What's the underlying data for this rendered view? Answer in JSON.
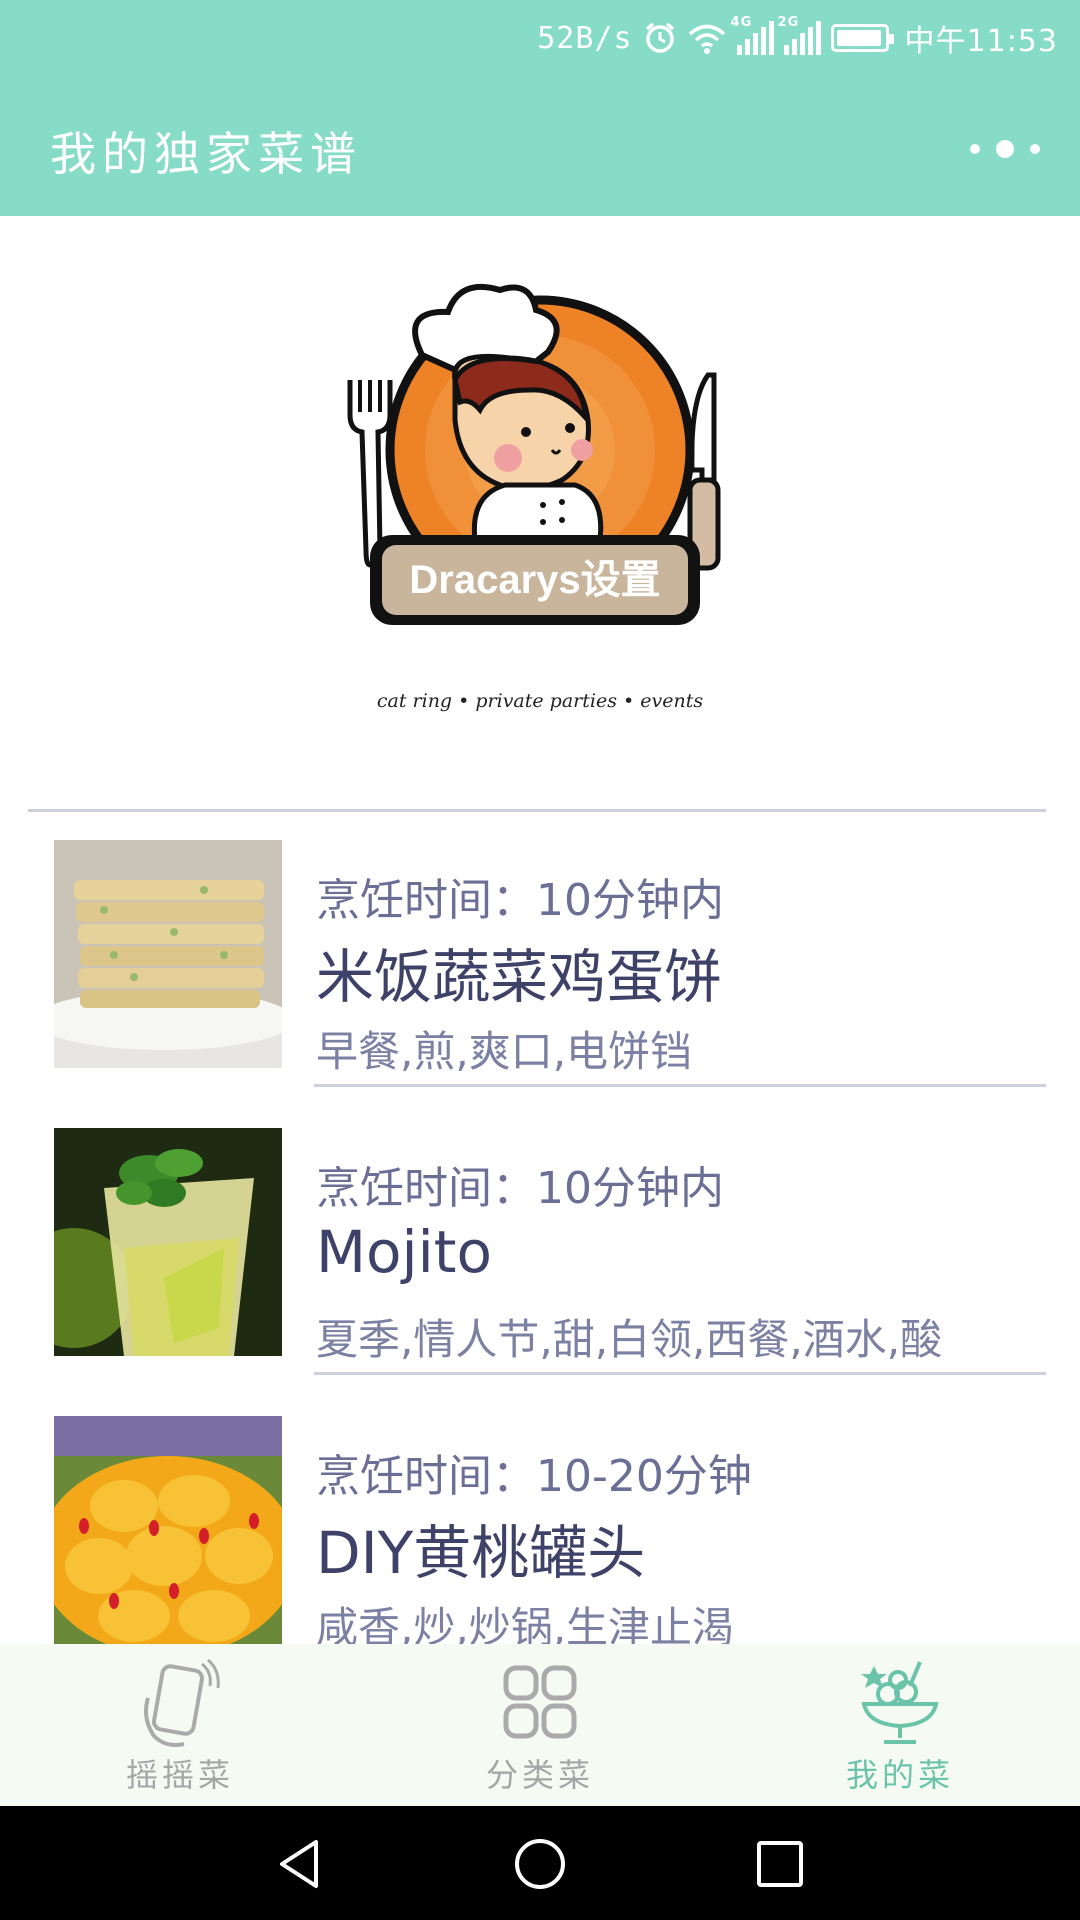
{
  "status_bar": {
    "net_speed": "52B/s",
    "signal1_tag": "4G",
    "signal2_tag": "2G",
    "time": "中午11:53"
  },
  "app_bar": {
    "title": "我的独家菜谱"
  },
  "logo": {
    "badge_text": "Dracarys设置",
    "tagline": "cat ring • private parties • events"
  },
  "recipes": [
    {
      "time": "烹饪时间：10分钟内",
      "name": "米饭蔬菜鸡蛋饼",
      "tags": "早餐,煎,爽口,电饼铛"
    },
    {
      "time": "烹饪时间：10分钟内",
      "name": "Mojito",
      "tags": "夏季,情人节,甜,白领,西餐,酒水,酸"
    },
    {
      "time": "烹饪时间：10-20分钟",
      "name": "DIY黄桃罐头",
      "tags": "咸香,炒,炒锅,生津止渴"
    }
  ],
  "bottom_nav": {
    "tabs": [
      {
        "label": "摇摇菜",
        "icon": "shake-phone-icon",
        "active": false
      },
      {
        "label": "分类菜",
        "icon": "grid-icon",
        "active": false
      },
      {
        "label": "我的菜",
        "icon": "dessert-cup-icon",
        "active": true
      }
    ]
  },
  "colors": {
    "accent": "#86dcc6",
    "active_tab": "#6bc4aa",
    "text_primary": "#3f4268",
    "text_secondary": "#6b6f96"
  }
}
